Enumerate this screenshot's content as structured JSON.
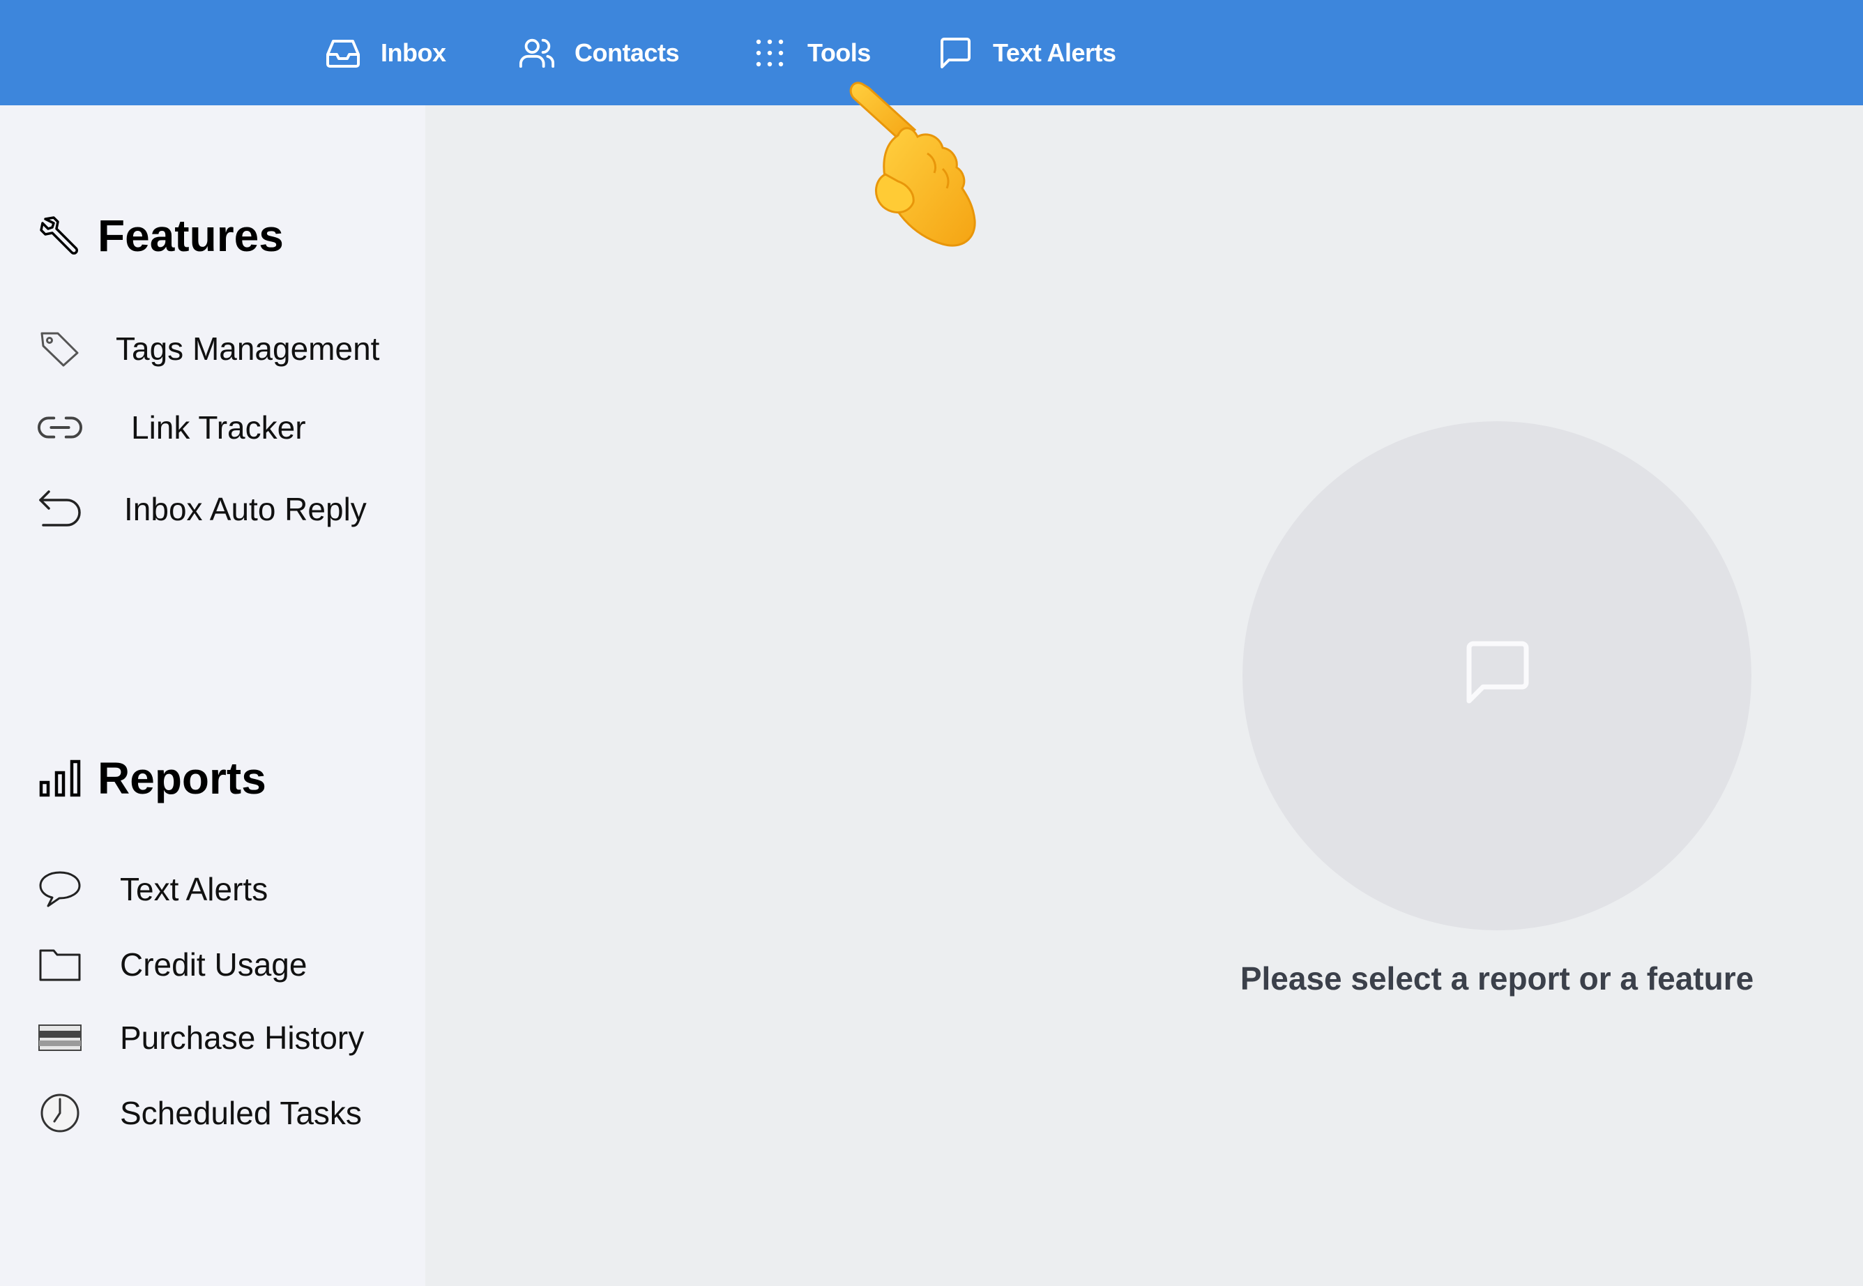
{
  "nav": {
    "inbox": "Inbox",
    "contacts": "Contacts",
    "tools": "Tools",
    "text_alerts": "Text Alerts"
  },
  "features": {
    "title": "Features",
    "items": [
      {
        "label": "Tags Management",
        "icon": "tag-icon"
      },
      {
        "label": "Link Tracker",
        "icon": "link-icon"
      },
      {
        "label": "Inbox Auto Reply",
        "icon": "reply-icon"
      }
    ]
  },
  "reports": {
    "title": "Reports",
    "items": [
      {
        "label": "Text Alerts",
        "icon": "speech-bubble-icon"
      },
      {
        "label": "Credit Usage",
        "icon": "folder-icon"
      },
      {
        "label": "Purchase History",
        "icon": "credit-card-icon"
      },
      {
        "label": "Scheduled Tasks",
        "icon": "clock-icon"
      }
    ]
  },
  "main": {
    "empty_message": "Please select a report or a feature"
  },
  "colors": {
    "topbar": "#3d86dc",
    "sidebar": "#f2f3f8",
    "main_bg": "#eceef0",
    "empty_circle": "#e1e2e6"
  }
}
